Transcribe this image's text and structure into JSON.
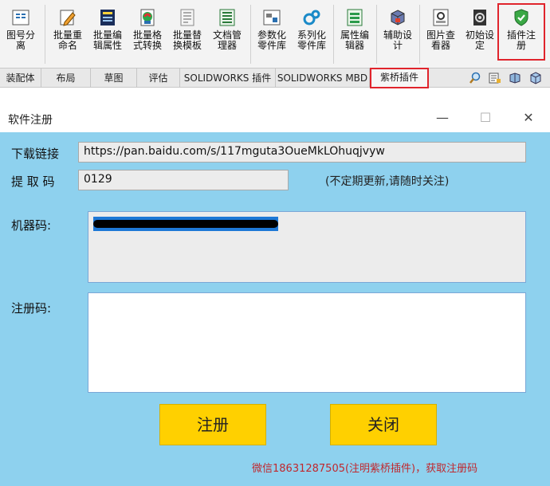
{
  "ribbon": {
    "buttons": [
      {
        "label": "图号分\n离",
        "icon": "drawing-split-icon"
      },
      {
        "label": "批量重\n命名",
        "icon": "batch-rename-icon"
      },
      {
        "label": "批量编\n辑属性",
        "icon": "batch-edit-properties-icon"
      },
      {
        "label": "批量格\n式转换",
        "icon": "batch-format-convert-icon"
      },
      {
        "label": "批量替\n换模板",
        "icon": "batch-replace-template-icon"
      },
      {
        "label": "文档管\n理器",
        "icon": "document-manager-icon"
      },
      {
        "label": "参数化\n零件库",
        "icon": "parametric-parts-icon"
      },
      {
        "label": "系列化\n零件库",
        "icon": "series-parts-icon"
      },
      {
        "label": "属性编\n辑器",
        "icon": "property-editor-icon"
      },
      {
        "label": "辅助设\n计",
        "icon": "assist-design-icon"
      },
      {
        "label": "图片查\n看器",
        "icon": "image-viewer-icon"
      },
      {
        "label": "初始设\n定",
        "icon": "initial-settings-icon"
      },
      {
        "label": "插件注\n册",
        "icon": "plugin-register-shield-icon"
      }
    ]
  },
  "tabs": [
    {
      "label": "装配体"
    },
    {
      "label": "布局"
    },
    {
      "label": "草图"
    },
    {
      "label": "评估"
    },
    {
      "label": "SOLIDWORKS 插件"
    },
    {
      "label": "SOLIDWORKS MBD"
    },
    {
      "label": "紫桥插件"
    }
  ],
  "dialog": {
    "title": "软件注册",
    "minimize": "—",
    "maximize": "☐",
    "close": "✕",
    "download_label": "下载链接",
    "download_value": "https://pan.baidu.com/s/117mguta3OueMkLOhuqjvyw",
    "code_label": "提 取 码",
    "code_value": "0129",
    "code_note": "(不定期更新,请随时关注)",
    "machine_label": "机器码:",
    "machine_value": "",
    "register_label": "注册码:",
    "register_value": "",
    "register_button": "注册",
    "close_button": "关闭",
    "footer": "微信18631287505(注明紫桥插件)，获取注册码"
  },
  "colors": {
    "client_bg": "#8ed1ee",
    "button_bg": "#ffd000",
    "highlight_red": "#e0242c",
    "footer_red": "#c0282e"
  }
}
